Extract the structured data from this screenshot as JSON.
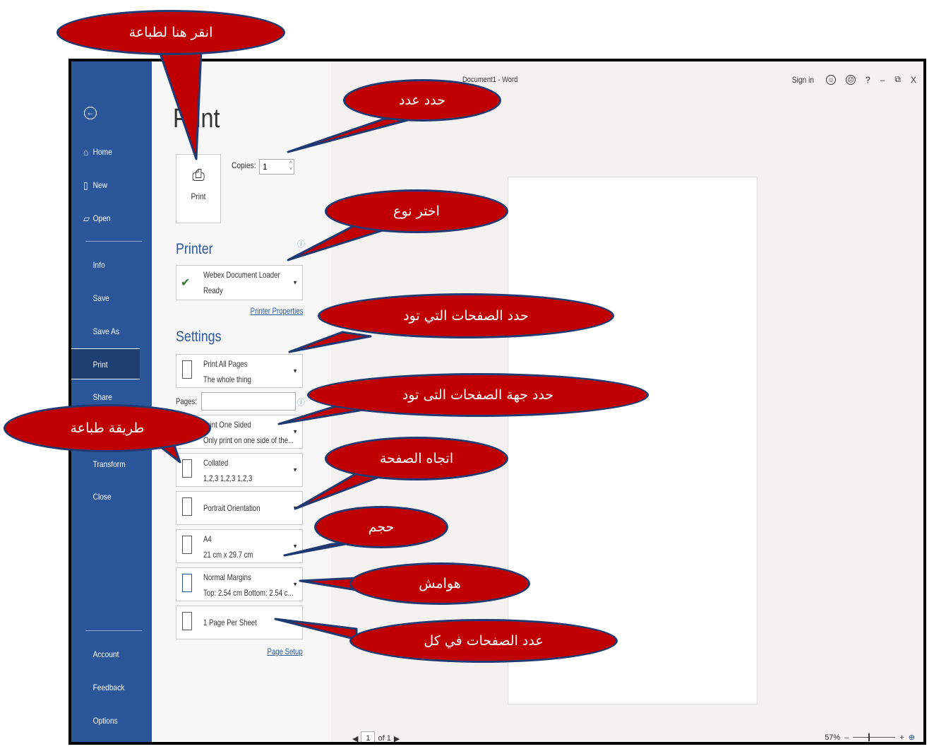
{
  "window": {
    "title": "Document1 - Word",
    "sign_in": "Sign in",
    "help": "?",
    "minimize": "–",
    "restore": "⧉",
    "close": "X"
  },
  "sidebar": {
    "back_glyph": "←",
    "items": [
      {
        "label": "Home",
        "icon": "home-icon",
        "glyph": "⌂"
      },
      {
        "label": "New",
        "icon": "new-document-icon",
        "glyph": "▯"
      },
      {
        "label": "Open",
        "icon": "open-folder-icon",
        "glyph": "▱"
      },
      {
        "label": "Info"
      },
      {
        "label": "Save"
      },
      {
        "label": "Save As"
      },
      {
        "label": "Print",
        "selected": true
      },
      {
        "label": "Share"
      },
      {
        "label": "Transform"
      },
      {
        "label": "Close"
      },
      {
        "label": "Account"
      },
      {
        "label": "Feedback"
      },
      {
        "label": "Options"
      }
    ]
  },
  "print_panel": {
    "heading": "Print",
    "print_button": "Print",
    "copies_label": "Copies:",
    "copies_value": "1",
    "printer_heading": "Printer",
    "printer_name": "Webex Document Loader",
    "printer_status": "Ready",
    "printer_properties": "Printer Properties",
    "settings_heading": "Settings",
    "pages_label": "Pages:",
    "settings": [
      {
        "line1": "Print All Pages",
        "line2": "The whole thing"
      },
      {
        "line1": "Print One Sided",
        "line2": "Only print on one side of the..."
      },
      {
        "line1": "Collated",
        "line2": "1,2,3   1,2,3   1,2,3"
      },
      {
        "line1": "Portrait Orientation",
        "line2": ""
      },
      {
        "line1": "A4",
        "line2": "21 cm x 29.7 cm"
      },
      {
        "line1": "Normal Margins",
        "line2": "Top: 2.54 cm Bottom: 2.54 c..."
      },
      {
        "line1": "1 Page Per Sheet",
        "line2": ""
      }
    ],
    "page_setup": "Page Setup"
  },
  "preview": {
    "page_number": "1",
    "page_of": "of 1",
    "zoom_level": "57%"
  },
  "callouts": {
    "print_here": "انقر هنا لطباعة",
    "select_count": "حدد عدد",
    "choose_type": "اختر نوع",
    "select_pages": "حدد الصفحات التي تود",
    "select_sides": "حدد جهة الصفحات التى تود",
    "print_method": "طريقة طباعة",
    "orientation": "اتجاه الصفحة",
    "size": "حجم",
    "margins": "هوامش",
    "pages_per_sheet": "عدد الصفحات في كل"
  },
  "colors": {
    "sidebar": "#2b579a",
    "callout_fill": "#c00000",
    "callout_border": "#1f3a73"
  }
}
